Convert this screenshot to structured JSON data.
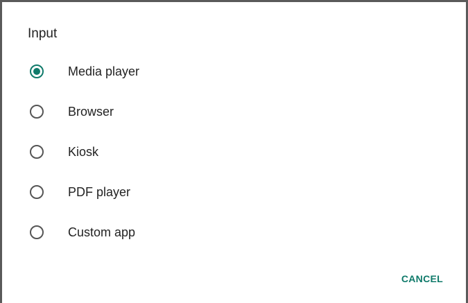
{
  "dialog": {
    "title": "Input",
    "options": [
      {
        "label": "Media player",
        "selected": true
      },
      {
        "label": "Browser",
        "selected": false
      },
      {
        "label": "Kiosk",
        "selected": false
      },
      {
        "label": "PDF player",
        "selected": false
      },
      {
        "label": "Custom app",
        "selected": false
      }
    ],
    "cancel_label": "CANCEL"
  },
  "colors": {
    "accent": "#0f7a6a",
    "text": "#222222",
    "radio_unchecked": "#555555"
  }
}
